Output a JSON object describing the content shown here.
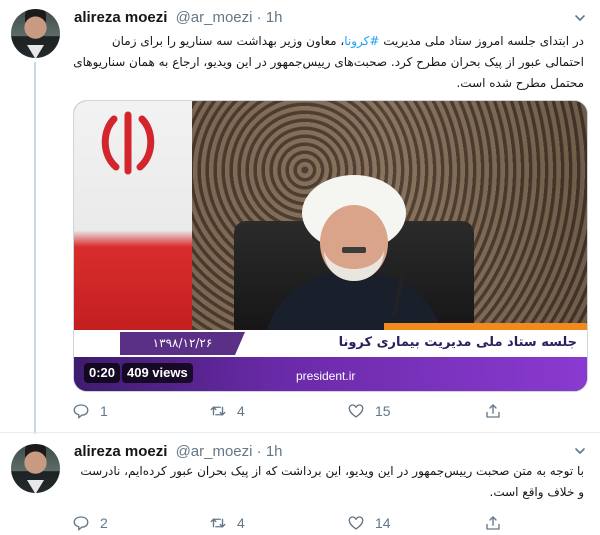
{
  "tweets": [
    {
      "author_name": "alireza moezi",
      "handle": "@ar_moezi",
      "separator": "·",
      "time": "1h",
      "text_before_hashtag": "در ابتدای جلسه امروز ستاد ملی مدیریت ",
      "hashtag": "#کرونا",
      "text_after_hashtag": "، معاون وزیر بهداشت سه سناریو را برای زمان احتمالی عبور از پیک بحران مطرح کرد. صحبت‌های رییس‌جمهور در این ویدیو، ارجاع به همان سناریوهای محتمل مطرح شده است.",
      "media": {
        "caption_title": "جلسه ستاد ملی مدیریت بیماری کرونا",
        "date_text": "۱۳۹۸/۱۲/۲۶",
        "website": "president.ir",
        "duration": "0:20",
        "views": "409 views"
      },
      "actions": {
        "replies": "1",
        "retweets": "4",
        "likes": "15"
      }
    },
    {
      "author_name": "alireza moezi",
      "handle": "@ar_moezi",
      "separator": "·",
      "time": "1h",
      "text": "با توجه به متن صحبت رییس‌جمهور در این ویدیو، این برداشت که از پیک بحران عبور کرده‌ایم، نادرست و خلاف واقع است.",
      "actions": {
        "replies": "2",
        "retweets": "4",
        "likes": "14"
      }
    }
  ],
  "colors": {
    "link": "#1da1f2",
    "secondary_text": "#657786",
    "border": "#e6ecf0",
    "purple_bar": "#6a2aa8",
    "orange_strip": "#f08a1c"
  },
  "icons": [
    "avatar",
    "caret-down-icon",
    "reply-icon",
    "retweet-icon",
    "like-icon",
    "share-icon"
  ]
}
